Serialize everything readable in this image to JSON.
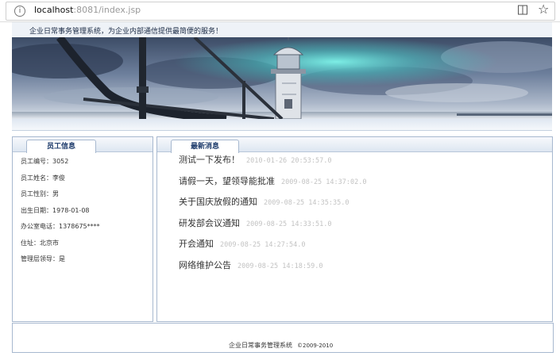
{
  "browser": {
    "url_host": "localhost",
    "url_path": ":8081/index.jsp"
  },
  "header": {
    "slogan": "企业日常事务管理系统，为企业内部通信提供最简便的服务！"
  },
  "employee_panel": {
    "tab_label": "员工信息",
    "fields": [
      {
        "label": "员工编号：",
        "value": "3052"
      },
      {
        "label": "员工姓名：",
        "value": "李俊"
      },
      {
        "label": "员工性别：",
        "value": "男"
      },
      {
        "label": "出生日期：",
        "value": "1978-01-08"
      },
      {
        "label": "办公室电话：",
        "value": "1378675****"
      },
      {
        "label": "住址：",
        "value": "北京市"
      },
      {
        "label": "管理层领导：",
        "value": "是"
      }
    ]
  },
  "news_panel": {
    "tab_label": "最新消息",
    "items": [
      {
        "title": "测试一下发布！",
        "date": "2010-01-26 20:53:57.0"
      },
      {
        "title": "请假一天，望领导能批准",
        "date": "2009-08-25 14:37:02.0"
      },
      {
        "title": "关于国庆放假的通知",
        "date": "2009-08-25 14:35:35.0"
      },
      {
        "title": "研发部会议通知",
        "date": "2009-08-25 14:33:51.0"
      },
      {
        "title": "开会通知",
        "date": "2009-08-25 14:27:54.0"
      },
      {
        "title": "网络维护公告",
        "date": "2009-08-25 14:18:59.0"
      }
    ]
  },
  "footer": {
    "system_name": "企业日常事务管理系统",
    "copyright": "©2009-2010"
  }
}
